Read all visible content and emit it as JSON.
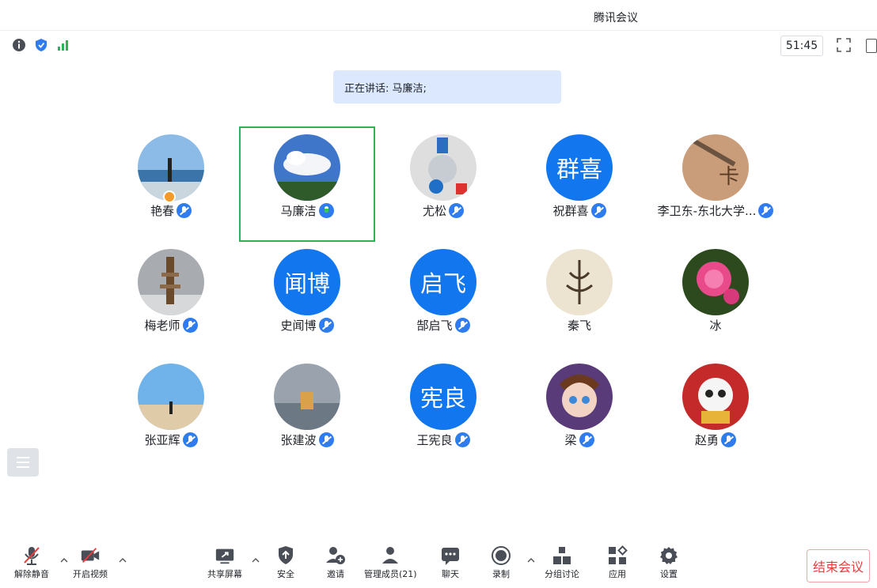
{
  "window": {
    "title": "腾讯会议"
  },
  "topbar": {
    "timer": "51:45"
  },
  "speaking": {
    "text": "正在讲话: 马廉洁;"
  },
  "participants": [
    {
      "name": "艳春",
      "avatar_text": "",
      "mic": "muted"
    },
    {
      "name": "马廉洁",
      "avatar_text": "",
      "mic": "speaking"
    },
    {
      "name": "尤松",
      "avatar_text": "",
      "mic": "muted"
    },
    {
      "name": "祝群喜",
      "avatar_text": "群喜",
      "mic": "muted"
    },
    {
      "name": "李卫东-东北大学...",
      "avatar_text": "",
      "mic": "muted"
    },
    {
      "name": "梅老师",
      "avatar_text": "",
      "mic": "muted"
    },
    {
      "name": "史闻博",
      "avatar_text": "闻博",
      "mic": "muted"
    },
    {
      "name": "郜启飞",
      "avatar_text": "启飞",
      "mic": "muted"
    },
    {
      "name": "秦飞",
      "avatar_text": "",
      "mic": "none"
    },
    {
      "name": "冰",
      "avatar_text": "",
      "mic": "none"
    },
    {
      "name": "张亚辉",
      "avatar_text": "",
      "mic": "muted"
    },
    {
      "name": "张建波",
      "avatar_text": "",
      "mic": "muted"
    },
    {
      "name": "王宪良",
      "avatar_text": "宪良",
      "mic": "muted"
    },
    {
      "name": "梁",
      "avatar_text": "",
      "mic": "muted"
    },
    {
      "name": "赵勇",
      "avatar_text": "",
      "mic": "muted"
    }
  ],
  "bottombar": {
    "unmute": "解除静音",
    "start_video": "开启视频",
    "share_screen": "共享屏幕",
    "security": "安全",
    "invite": "邀请",
    "manage_members": "管理成员(21)",
    "chat": "聊天",
    "record": "录制",
    "breakout": "分组讨论",
    "apps": "应用",
    "settings": "设置",
    "end_meeting": "结束会议"
  },
  "colors": {
    "accent": "#1277ef",
    "speaking_frame": "#2cb35a",
    "speaking_banner": "#dbe8fd",
    "end_text": "#e63d3d"
  }
}
